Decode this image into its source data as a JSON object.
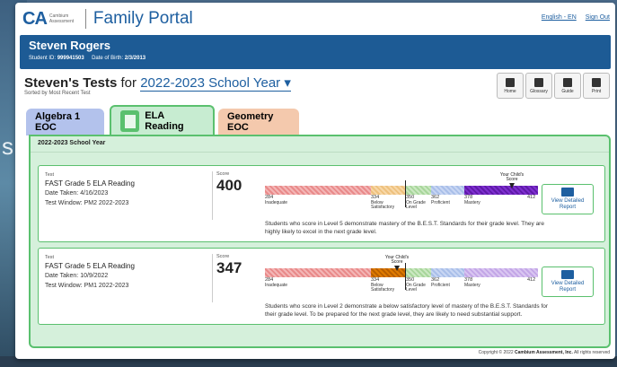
{
  "background": {
    "partial_text": "s"
  },
  "header": {
    "logo_mark": "CA",
    "logo_sub": "Cambium Assessment",
    "portal_title": "Family Portal",
    "language_link": "English - EN",
    "signout_link": "Sign Out"
  },
  "student": {
    "name": "Steven Rogers",
    "id_label": "Student ID:",
    "id_value": "999941503",
    "dob_label": "Date of Birth:",
    "dob_value": "2/3/2013"
  },
  "tests_heading": {
    "title": "Steven's Tests",
    "for": "for",
    "year_select": "2022-2023 School Year",
    "sorted": "Sorted by Most Recent Test"
  },
  "toolbar": [
    {
      "label": "Home",
      "icon": "home-icon"
    },
    {
      "label": "Glossary",
      "icon": "book-icon"
    },
    {
      "label": "Guide",
      "icon": "map-icon"
    },
    {
      "label": "Print",
      "icon": "print-icon"
    }
  ],
  "tabs": [
    {
      "label": "Algebra 1 EOC",
      "color": "#b3c2ec"
    },
    {
      "label": "ELA Reading",
      "color": "#c7ecd1",
      "active": true
    },
    {
      "label": "Geometry EOC",
      "color": "#f4c9ad"
    }
  ],
  "panel": {
    "year": "2022-2023 School Year"
  },
  "cards": [
    {
      "test_label": "Test",
      "test_name": "FAST Grade 5 ELA Reading",
      "date_label": "Date Taken:",
      "date": "4/16/2023",
      "window_label": "Test Window:",
      "window": "PM2 2022-2023",
      "score_label": "Score",
      "score": "400",
      "level": 5,
      "marker_label": "Your Child's Score",
      "description": "Students who score in Level 5 demonstrate mastery of the B.E.S.T. Standards for their grade level. They are highly likely to excel in the next grade level.",
      "button": "View Detailed Report"
    },
    {
      "test_label": "Test",
      "test_name": "FAST Grade 5 ELA Reading",
      "date_label": "Date Taken:",
      "date": "10/9/2022",
      "window_label": "Test Window:",
      "window": "PM1 2022-2023",
      "score_label": "Score",
      "score": "347",
      "level": 2,
      "marker_label": "Your Child's Score",
      "description": "Students who score in Level 2 demonstrate a below satisfactory level of mastery of the B.E.S.T. Standards for their grade level. To be prepared for the next grade level, they are likely to need substantial support.",
      "button": "View Detailed Report"
    }
  ],
  "scale": [
    {
      "cut": "284",
      "label": "Inadequate"
    },
    {
      "cut": "334",
      "label": "Below Satisfactory"
    },
    {
      "cut": "350",
      "label": "On Grade Level"
    },
    {
      "cut": "362",
      "label": "Proficient"
    },
    {
      "cut": "378",
      "label": "Mastery"
    },
    {
      "cut": "412",
      "label": ""
    }
  ],
  "footer": {
    "prefix": "Copyright © 2022",
    "company": "Cambium Assessment, Inc.",
    "suffix": "All rights reserved"
  }
}
